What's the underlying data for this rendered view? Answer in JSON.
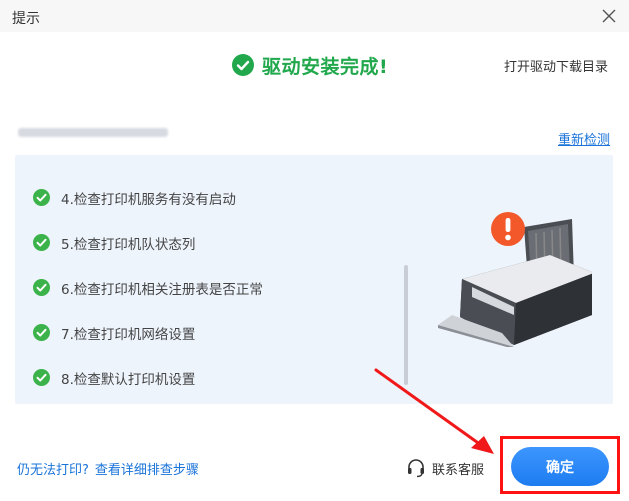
{
  "window": {
    "title": "提示",
    "close_icon": "close-icon"
  },
  "header": {
    "status_icon": "check-circle-icon",
    "status_text": "驱动安装完成!",
    "status_color": "#21a84c",
    "open_folder_link": "打开驱动下载目录"
  },
  "check_section": {
    "recheck_link": "重新检测",
    "items": [
      {
        "label": "4.检查打印机服务有没有启动",
        "icon": "check-circle-icon"
      },
      {
        "label": "5.检查打印机队状态列",
        "icon": "check-circle-icon"
      },
      {
        "label": "6.检查打印机相关注册表是否正常",
        "icon": "check-circle-icon"
      },
      {
        "label": "7.检查打印机网络设置",
        "icon": "check-circle-icon"
      },
      {
        "label": "8.检查默认打印机设置",
        "icon": "check-circle-icon"
      }
    ],
    "illustration_icon": "printer-warning-icon"
  },
  "footer": {
    "help_text": "仍无法打印?",
    "help_link": "查看详细排查步骤",
    "support_icon": "headset-icon",
    "support_label": "联系客服",
    "confirm_label": "确定",
    "accent_color": "#1e7cf0",
    "highlight_color": "#ff1212"
  }
}
